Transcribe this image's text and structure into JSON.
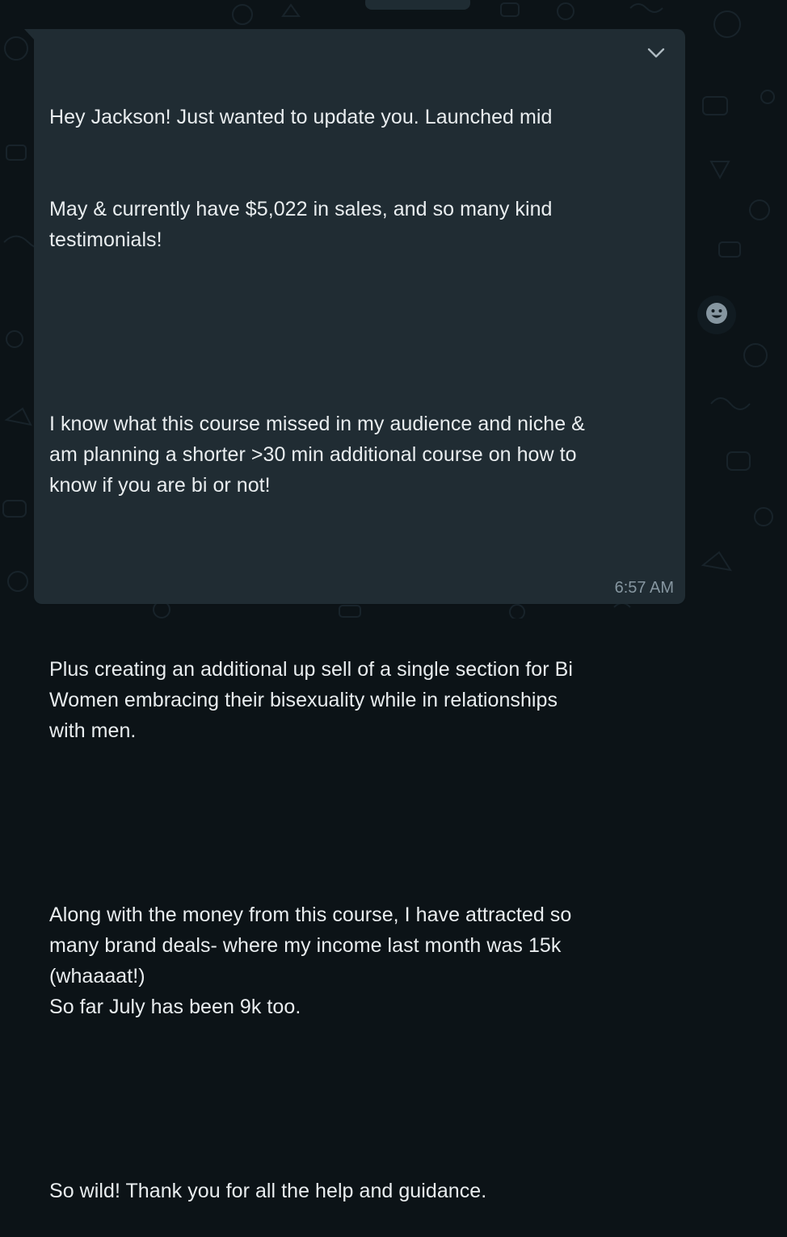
{
  "message": {
    "first_line": "Hey Jackson! Just wanted to update you. Launched mid",
    "paragraph1_rest": "May & currently have $5,022 in sales, and so many kind\ntestimonials!",
    "paragraph2": "I know what this course missed in my audience and niche &\nam planning a shorter >30 min additional course on how to\nknow if you are bi or not!",
    "paragraph3": "Plus creating an additional up sell of a single section for Bi\nWomen embracing their bisexuality while in relationships\nwith men.",
    "paragraph4": "Along with the money from this course, I have attracted so\nmany brand deals- where my income last month was 15k\n(whaaaat!)\nSo far July has been 9k too.",
    "paragraph5": "So wild! Thank you for all the help and guidance.",
    "timestamp": "6:57 AM"
  },
  "icons": {
    "menu": "chevron-down-icon",
    "react": "smiley-icon"
  },
  "colors": {
    "background": "#0c1317",
    "bubble": "#202c33",
    "text": "#e9edef",
    "meta": "#8696a0"
  }
}
